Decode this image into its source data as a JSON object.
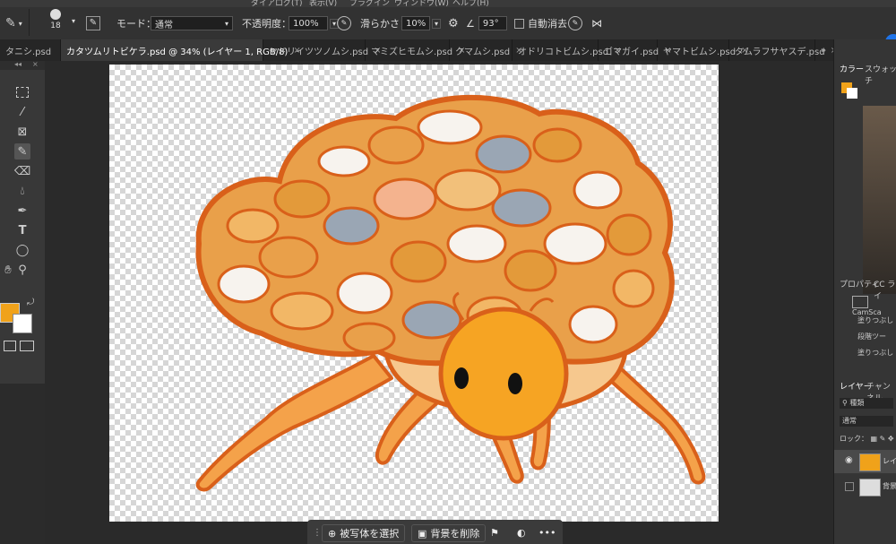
{
  "menubar": {
    "items": [
      "ダイアログ(T)",
      "表示(V)",
      "プラグイン",
      "ウィンドウ(W)",
      "ヘルプ(H)"
    ]
  },
  "options_bar": {
    "brush_size": "18",
    "mode_label": "モード：",
    "mode_value": "通常",
    "opacity_label": "不透明度：",
    "opacity_value": "100%",
    "smoothing_label": "滑らかさ：",
    "smoothing_value": "10%",
    "angle_value": "93°",
    "auto_erase_label": "自動消去"
  },
  "tabs": [
    {
      "label": "タニシ.psd",
      "active": false
    },
    {
      "label": "カタツムリトビケラ.psd @ 34% (レイヤー 1, RGB/8)",
      "active": true
    },
    {
      "label": "ヤドリイツツノムシ.psd",
      "active": false
    },
    {
      "label": "マミズヒモムシ.psd",
      "active": false
    },
    {
      "label": "クマムシ.psd",
      "active": false
    },
    {
      "label": "オドリコトビムシ.psd",
      "active": false
    },
    {
      "label": "ゴマガイ.psd",
      "active": false
    },
    {
      "label": "ヤマトビムシ.psd",
      "active": false
    },
    {
      "label": "タムラフサヤスデ.psd",
      "active": false
    }
  ],
  "tab_overflow": "»",
  "colors": {
    "foreground": "#f0a21a",
    "background": "#ffffff",
    "accent_blue": "#1e73e8"
  },
  "right_panel": {
    "top_tabs": [
      "カラー",
      "スウォッチ"
    ],
    "props_tabs": [
      "プロパティ",
      "CC ライ"
    ],
    "props_items": [
      "CamSca",
      "塗りつぶし",
      "段階ツー",
      "塗りつぶし"
    ],
    "layer_tabs": [
      "レイヤー",
      "チャンネル"
    ],
    "layer_search": "種類",
    "blend_mode": "通常",
    "lock_label": "ロック：",
    "layers": [
      "レイ",
      "背景"
    ]
  },
  "bottom_bar": {
    "select_subject": "被写体を選択",
    "remove_bg": "背景を削除",
    "more": "•••"
  },
  "canvas": {
    "zoom": "34%",
    "layer": "レイヤー 1"
  }
}
